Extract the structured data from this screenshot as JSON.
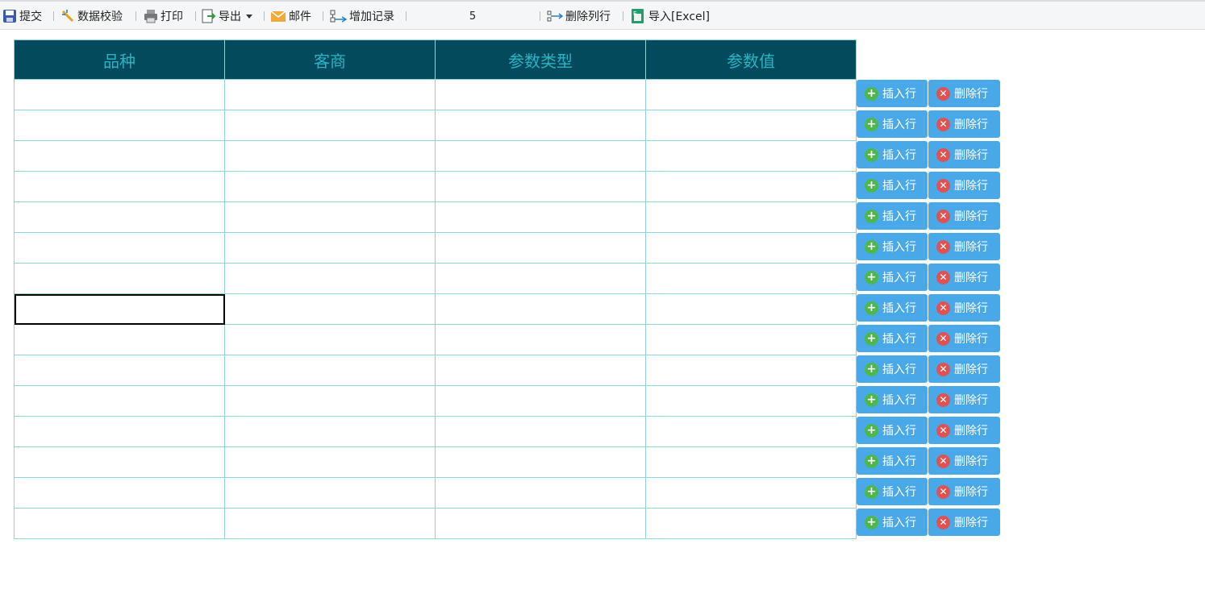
{
  "toolbar": {
    "submit": "提交",
    "validate": "数据校验",
    "print": "打印",
    "export": "导出",
    "mail": "邮件",
    "add_record": "增加记录",
    "record_count": "5",
    "delete_column_row": "删除列行",
    "import_excel": "导入[Excel]"
  },
  "table": {
    "headers": [
      "品种",
      "客商",
      "参数类型",
      "参数值"
    ],
    "row_count": 15,
    "active_cell": {
      "row": 8,
      "col": 1
    }
  },
  "row_actions": {
    "insert_label": "插入行",
    "delete_label": "删除行"
  },
  "colors": {
    "header_bg": "#024a5c",
    "header_text": "#29b3c2",
    "grid_border": "#8fd3d6",
    "action_button": "#49a9e8"
  }
}
